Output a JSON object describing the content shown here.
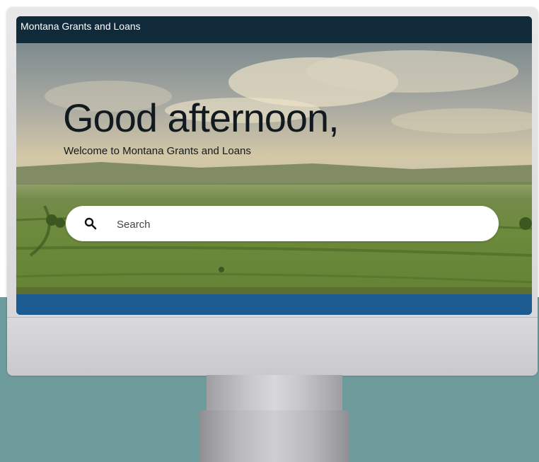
{
  "app": {
    "title": "Montana Grants and Loans"
  },
  "hero": {
    "greeting": "Good afternoon,",
    "welcome": "Welcome to Montana Grants and Loans"
  },
  "search": {
    "placeholder": "Search",
    "value": "",
    "icon": "search-icon"
  },
  "colors": {
    "topbar": "#102a3a",
    "accent_bar": "#1b5b8f",
    "background_teal": "#6e9c9c"
  }
}
